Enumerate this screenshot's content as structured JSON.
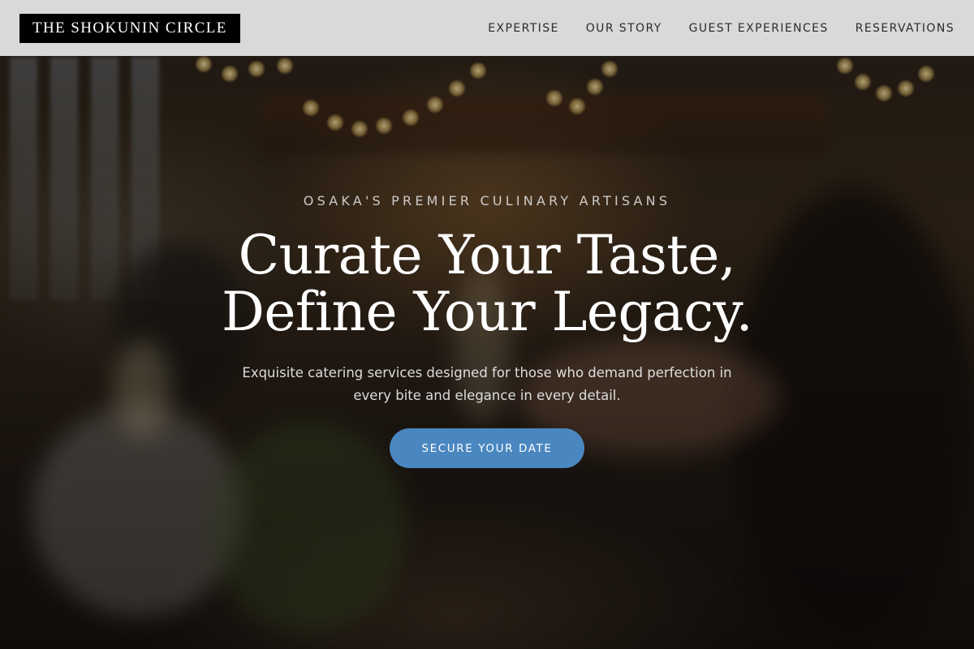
{
  "header": {
    "logo_text": "THE SHOKUNIN CIRCLE",
    "nav": [
      {
        "label": "EXPERTISE"
      },
      {
        "label": "OUR STORY"
      },
      {
        "label": "GUEST EXPERIENCES"
      },
      {
        "label": "RESERVATIONS"
      }
    ]
  },
  "hero": {
    "eyebrow": "OSAKA'S PREMIER CULINARY ARTISANS",
    "headline_line1": "Curate Your Taste,",
    "headline_line2": "Define Your Legacy.",
    "subcopy": "Exquisite catering services designed for those who demand perfection in every bite and elegance in every detail.",
    "cta_label": "SECURE YOUR DATE",
    "background_image": "dimmed banquet hall photo: guests raising champagne glasses, string lights overhead"
  },
  "colors": {
    "header_bg": "#e8e8e8",
    "logo_bg": "#000000",
    "nav_text": "#2b2b2b",
    "cta_bg": "#4a87c0",
    "hero_text": "#ffffff"
  }
}
